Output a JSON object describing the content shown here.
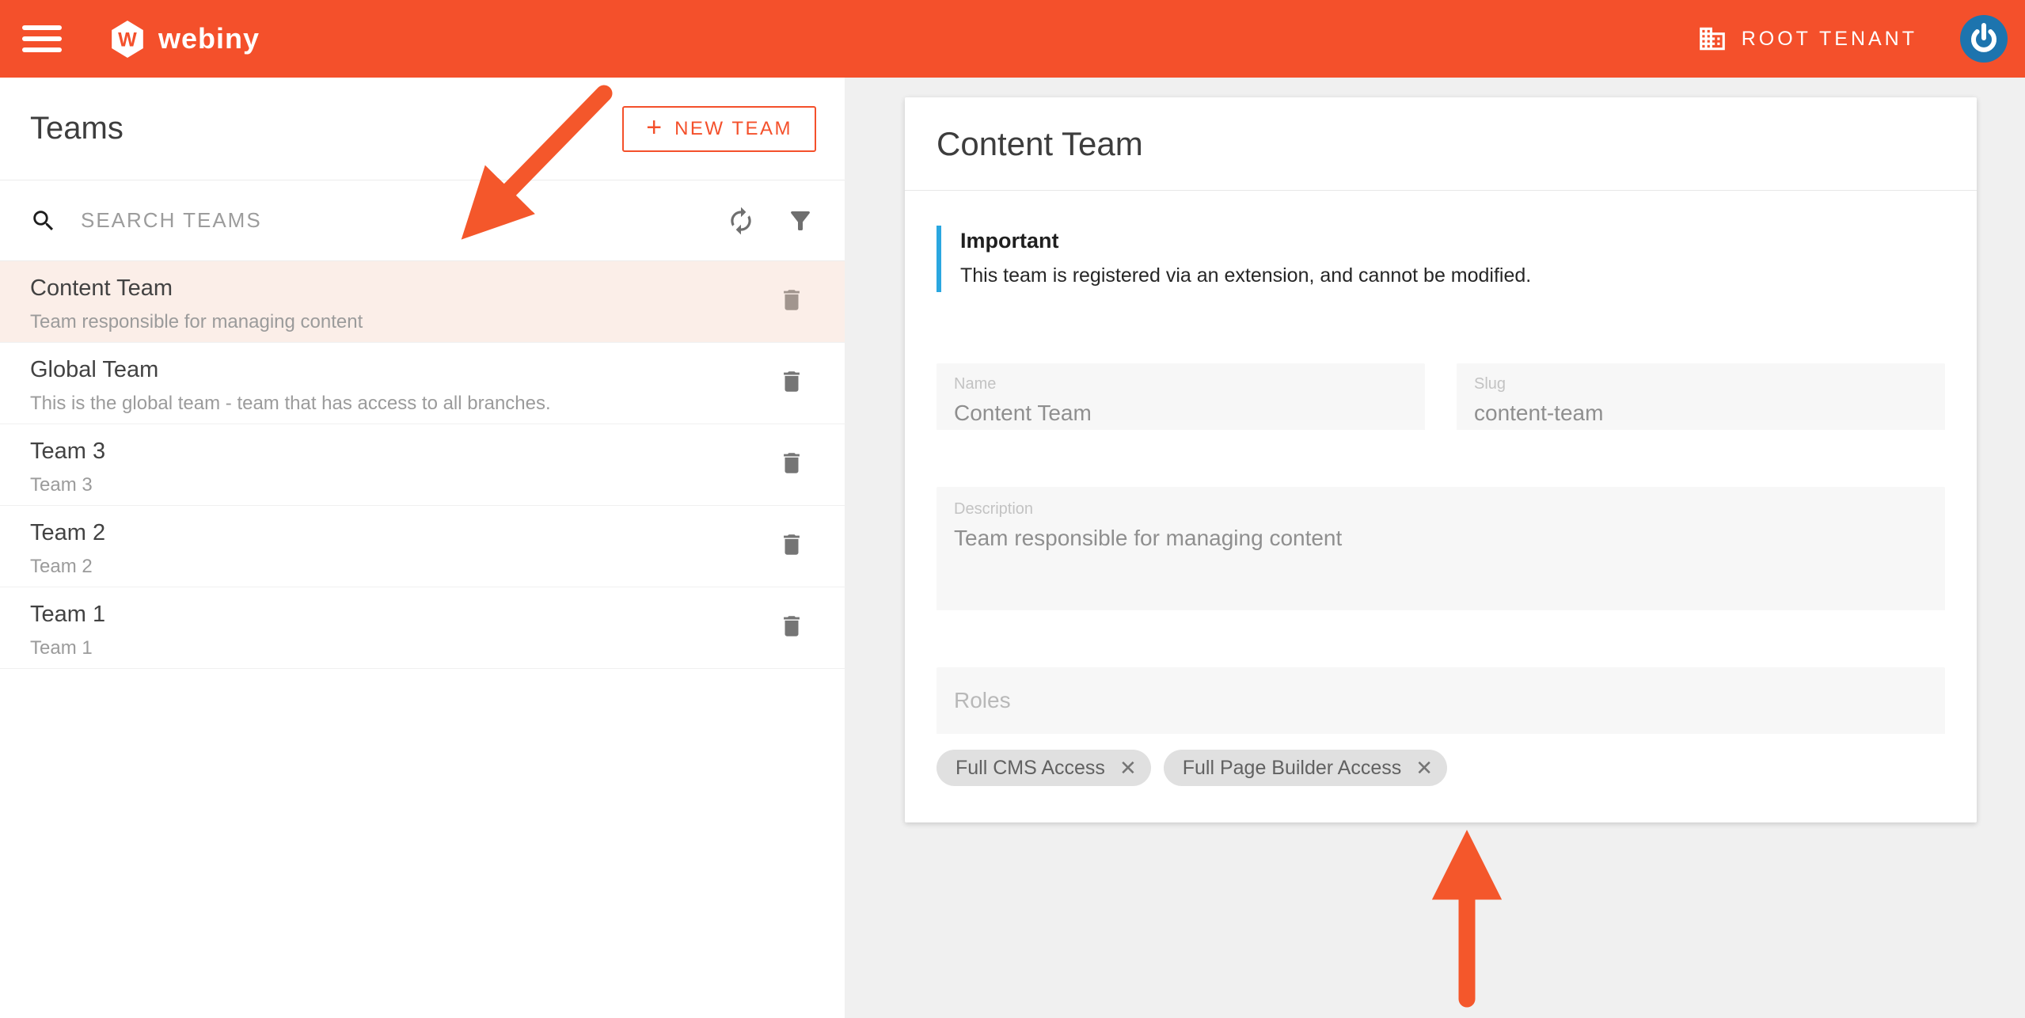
{
  "header": {
    "brand": "webiny",
    "logo_letter": "W",
    "tenant_label": "ROOT TENANT"
  },
  "left_panel": {
    "title": "Teams",
    "new_button": {
      "plus": "+",
      "label": "NEW TEAM"
    },
    "search_placeholder": "SEARCH TEAMS",
    "teams": [
      {
        "name": "Content Team",
        "description": "Team responsible for managing content",
        "selected": true
      },
      {
        "name": "Global Team",
        "description": "This is the global team - team that has access to all branches.",
        "selected": false
      },
      {
        "name": "Team 3",
        "description": "Team 3",
        "selected": false
      },
      {
        "name": "Team 2",
        "description": "Team 2",
        "selected": false
      },
      {
        "name": "Team 1",
        "description": "Team 1",
        "selected": false
      }
    ]
  },
  "detail": {
    "title": "Content Team",
    "alert": {
      "title": "Important",
      "message": "This team is registered via an extension, and cannot be modified."
    },
    "fields": {
      "name": {
        "label": "Name",
        "value": "Content Team"
      },
      "slug": {
        "label": "Slug",
        "value": "content-team"
      },
      "description": {
        "label": "Description",
        "value": "Team responsible for managing content"
      },
      "roles": {
        "label": "Roles"
      }
    },
    "chips": [
      {
        "label": "Full CMS Access"
      },
      {
        "label": "Full Page Builder Access"
      }
    ]
  },
  "icons": {
    "close": "✕"
  },
  "colors": {
    "appbar_orange": "#F4502B",
    "arrow_orange": "#F4572B",
    "alert_blue": "#2AA7E0",
    "avatar_blue": "#1D74AE",
    "selected_row_bg": "#FBEEE8",
    "page_bg": "#F0F0F0",
    "field_bg": "#F7F7F7",
    "chip_bg": "#E0E0E0"
  }
}
